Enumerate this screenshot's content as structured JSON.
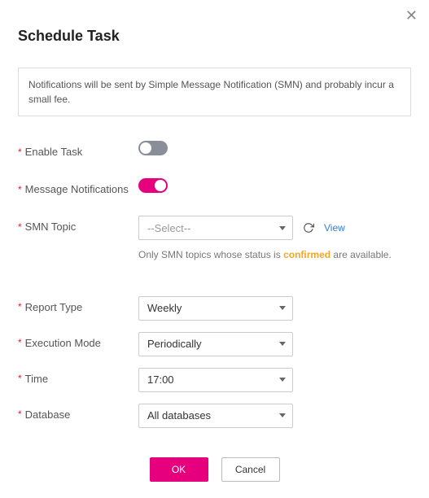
{
  "title": "Schedule Task",
  "info_notice": "Notifications will be sent by Simple Message Notification (SMN) and probably incur a small fee.",
  "fields": {
    "enable_task": {
      "label": "Enable Task",
      "value": false
    },
    "message_notifications": {
      "label": "Message Notifications",
      "value": true
    },
    "smn_topic": {
      "label": "SMN Topic",
      "placeholder": "--Select--",
      "hint_prefix": "Only SMN topics whose status is ",
      "hint_highlight": "confirmed",
      "hint_suffix": " are available.",
      "view_link": "View"
    },
    "report_type": {
      "label": "Report Type",
      "value": "Weekly"
    },
    "execution_mode": {
      "label": "Execution Mode",
      "value": "Periodically"
    },
    "time": {
      "label": "Time",
      "value": "17:00"
    },
    "database": {
      "label": "Database",
      "value": "All databases"
    }
  },
  "buttons": {
    "ok": "OK",
    "cancel": "Cancel"
  },
  "required_marker": "*"
}
